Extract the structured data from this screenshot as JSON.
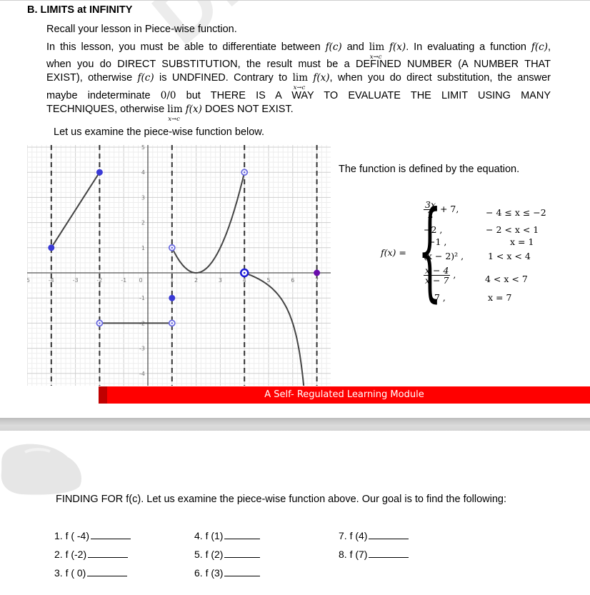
{
  "watermark": "DHS",
  "section": {
    "heading": "B.  LIMITS at INFINITY",
    "recall": "Recall your lesson in Piece-wise function.",
    "para1": {
      "t1": "In this lesson, you must be able to differentiate between ",
      "fc": "f(c)",
      "t2": " and ",
      "lim": "lim",
      "lim_sub": "x→c",
      "fx": "f(x)",
      "t3": ". In evaluating a function ",
      "t4": ","
    },
    "line2": "when you do DIRECT SUBSTITUTION, the result must be a DEFINED NUMBER (A NUMBER THAT",
    "line3": {
      "t1": "EXIST), otherwise ",
      "fc": "f(c)",
      "t2": " is UNDFINED. Contrary to ",
      "lim": "lim",
      "lim_sub": "x→c",
      "fx": "f(x)",
      "t3": ", when you do direct substitution, the answer"
    },
    "line4": {
      "t1": "maybe indeterminate ",
      "zero": "0/0",
      "t2": " but THERE IS A WAY TO EVALUATE THE LIMIT USING MANY"
    },
    "line5": {
      "t1": "TECHNIQUES, otherwise ",
      "lim": "lim",
      "lim_sub": "x→c",
      "fx": "f(x)",
      "t2": " DOES NOT EXIST."
    },
    "examine": "Let us examine the piece-wise function below."
  },
  "chart_data": {
    "type": "line",
    "title": "",
    "xlabel": "",
    "ylabel": "",
    "xlim": [
      -5,
      7.5
    ],
    "ylim": [
      -4.5,
      5.2
    ],
    "grid": true,
    "x_ticks": [
      "-5",
      "-4",
      "-3",
      "-2",
      "-1",
      "0",
      "1",
      "2",
      "3",
      "4",
      "5",
      "6",
      "7"
    ],
    "y_ticks": [
      "-4",
      "-3",
      "-2",
      "-1",
      "1",
      "2",
      "3",
      "4",
      "5"
    ],
    "asymptote_lines_x": [
      -4,
      -2,
      1,
      4,
      7
    ],
    "series": [
      {
        "name": "3x/2 + 7",
        "domain": [
          -4,
          -2
        ],
        "points": [
          [
            -4,
            1
          ],
          [
            -2,
            4
          ]
        ]
      },
      {
        "name": "-2",
        "domain": [
          -2,
          1
        ],
        "points": [
          [
            -2,
            -2
          ],
          [
            1,
            -2
          ]
        ]
      },
      {
        "name": "(x-2)^2",
        "domain": [
          1,
          4
        ],
        "function": "(x-2)^2"
      },
      {
        "name": "(x-4)/(x-7)",
        "domain": [
          4,
          6.55
        ],
        "function": "(x-4)/(x-7)"
      }
    ],
    "markers": [
      {
        "x": -4,
        "y": 1,
        "style": "closed"
      },
      {
        "x": -2,
        "y": 4,
        "style": "closed"
      },
      {
        "x": -2,
        "y": -2,
        "style": "open"
      },
      {
        "x": 1,
        "y": -2,
        "style": "open"
      },
      {
        "x": 1,
        "y": -1,
        "style": "closed"
      },
      {
        "x": 1,
        "y": 1,
        "style": "open"
      },
      {
        "x": 4,
        "y": 4,
        "style": "open"
      },
      {
        "x": 4,
        "y": 0,
        "style": "open"
      },
      {
        "x": 7,
        "y": 0,
        "style": "closed-purple"
      }
    ]
  },
  "equation": {
    "caption": "The function is defined by the equation.",
    "lhs": "f(x) =",
    "cases": [
      {
        "num": "3x",
        "den": "2",
        "rest": " + 7,",
        "cond": "− 4 ≤ x ≤ −2"
      },
      {
        "expr": "−2   ,",
        "cond": "− 2 < x < 1"
      },
      {
        "expr": "−1 ,",
        "cond": "x = 1"
      },
      {
        "expr": "(x − 2)² ,",
        "cond": "1 < x < 4"
      },
      {
        "num": "x − 4",
        "den": "x − 7",
        "rest": " ,",
        "cond": "4 < x < 7"
      },
      {
        "expr": "7 ,",
        "cond": "x = 7"
      }
    ]
  },
  "banner": {
    "text": "A Self- Regulated Learning Module",
    "color": "#ff0000"
  },
  "finding": "FINDING FOR f(c). Let us examine the piece-wise function above. Our goal is to find the following:",
  "exercises": [
    {
      "label": "1. f ( -4)"
    },
    {
      "label": "2. f (-2)"
    },
    {
      "label": "3. f ( 0)"
    },
    {
      "label": "4. f (1)"
    },
    {
      "label": "5. f (2)"
    },
    {
      "label": "6. f (3)"
    },
    {
      "label": "7. f (4)"
    },
    {
      "label": "8. f (7)"
    }
  ]
}
